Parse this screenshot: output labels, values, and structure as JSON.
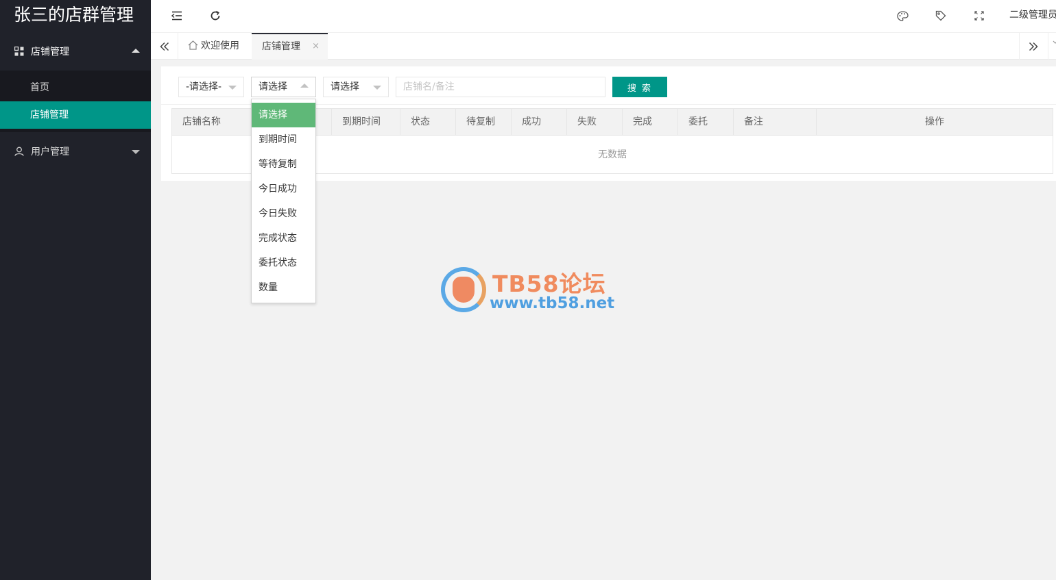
{
  "app": {
    "title": "张三的店群管理"
  },
  "sidebar": {
    "groups": [
      {
        "label": "店铺管理",
        "expanded": true,
        "children": [
          {
            "label": "首页",
            "active": false
          },
          {
            "label": "店铺管理",
            "active": true
          }
        ]
      },
      {
        "label": "用户管理",
        "expanded": false
      }
    ]
  },
  "header": {
    "icons": [
      "menu-fold-icon",
      "refresh-icon",
      "theme-palette-icon",
      "tag-icon",
      "fullscreen-icon"
    ],
    "user": "二级管理员"
  },
  "tabs": {
    "items": [
      {
        "label": "欢迎使用",
        "icon": "home-icon"
      },
      {
        "label": "店铺管理",
        "active": true
      }
    ],
    "close_glyph": "×"
  },
  "filters": {
    "select1": "-请选择-",
    "select2": "请选择",
    "select3": "请选择",
    "search_placeholder": "店铺名/备注",
    "search_button": "搜 索"
  },
  "dropdown": {
    "options": [
      "请选择",
      "到期时间",
      "等待复制",
      "今日成功",
      "今日失败",
      "完成状态",
      "委托状态",
      "数量"
    ],
    "selected_index": 0
  },
  "table": {
    "columns": [
      "店铺名称",
      "",
      "到期时间",
      "状态",
      "待复制",
      "成功",
      "失败",
      "完成",
      "委托",
      "备注",
      "操作"
    ],
    "empty_text": "无数据"
  },
  "watermark": {
    "title": "TB58论坛",
    "url": "www.tb58.net"
  },
  "colors": {
    "accent": "#009688",
    "sidebar_bg": "#20222a",
    "selected_option": "#5fb878"
  }
}
